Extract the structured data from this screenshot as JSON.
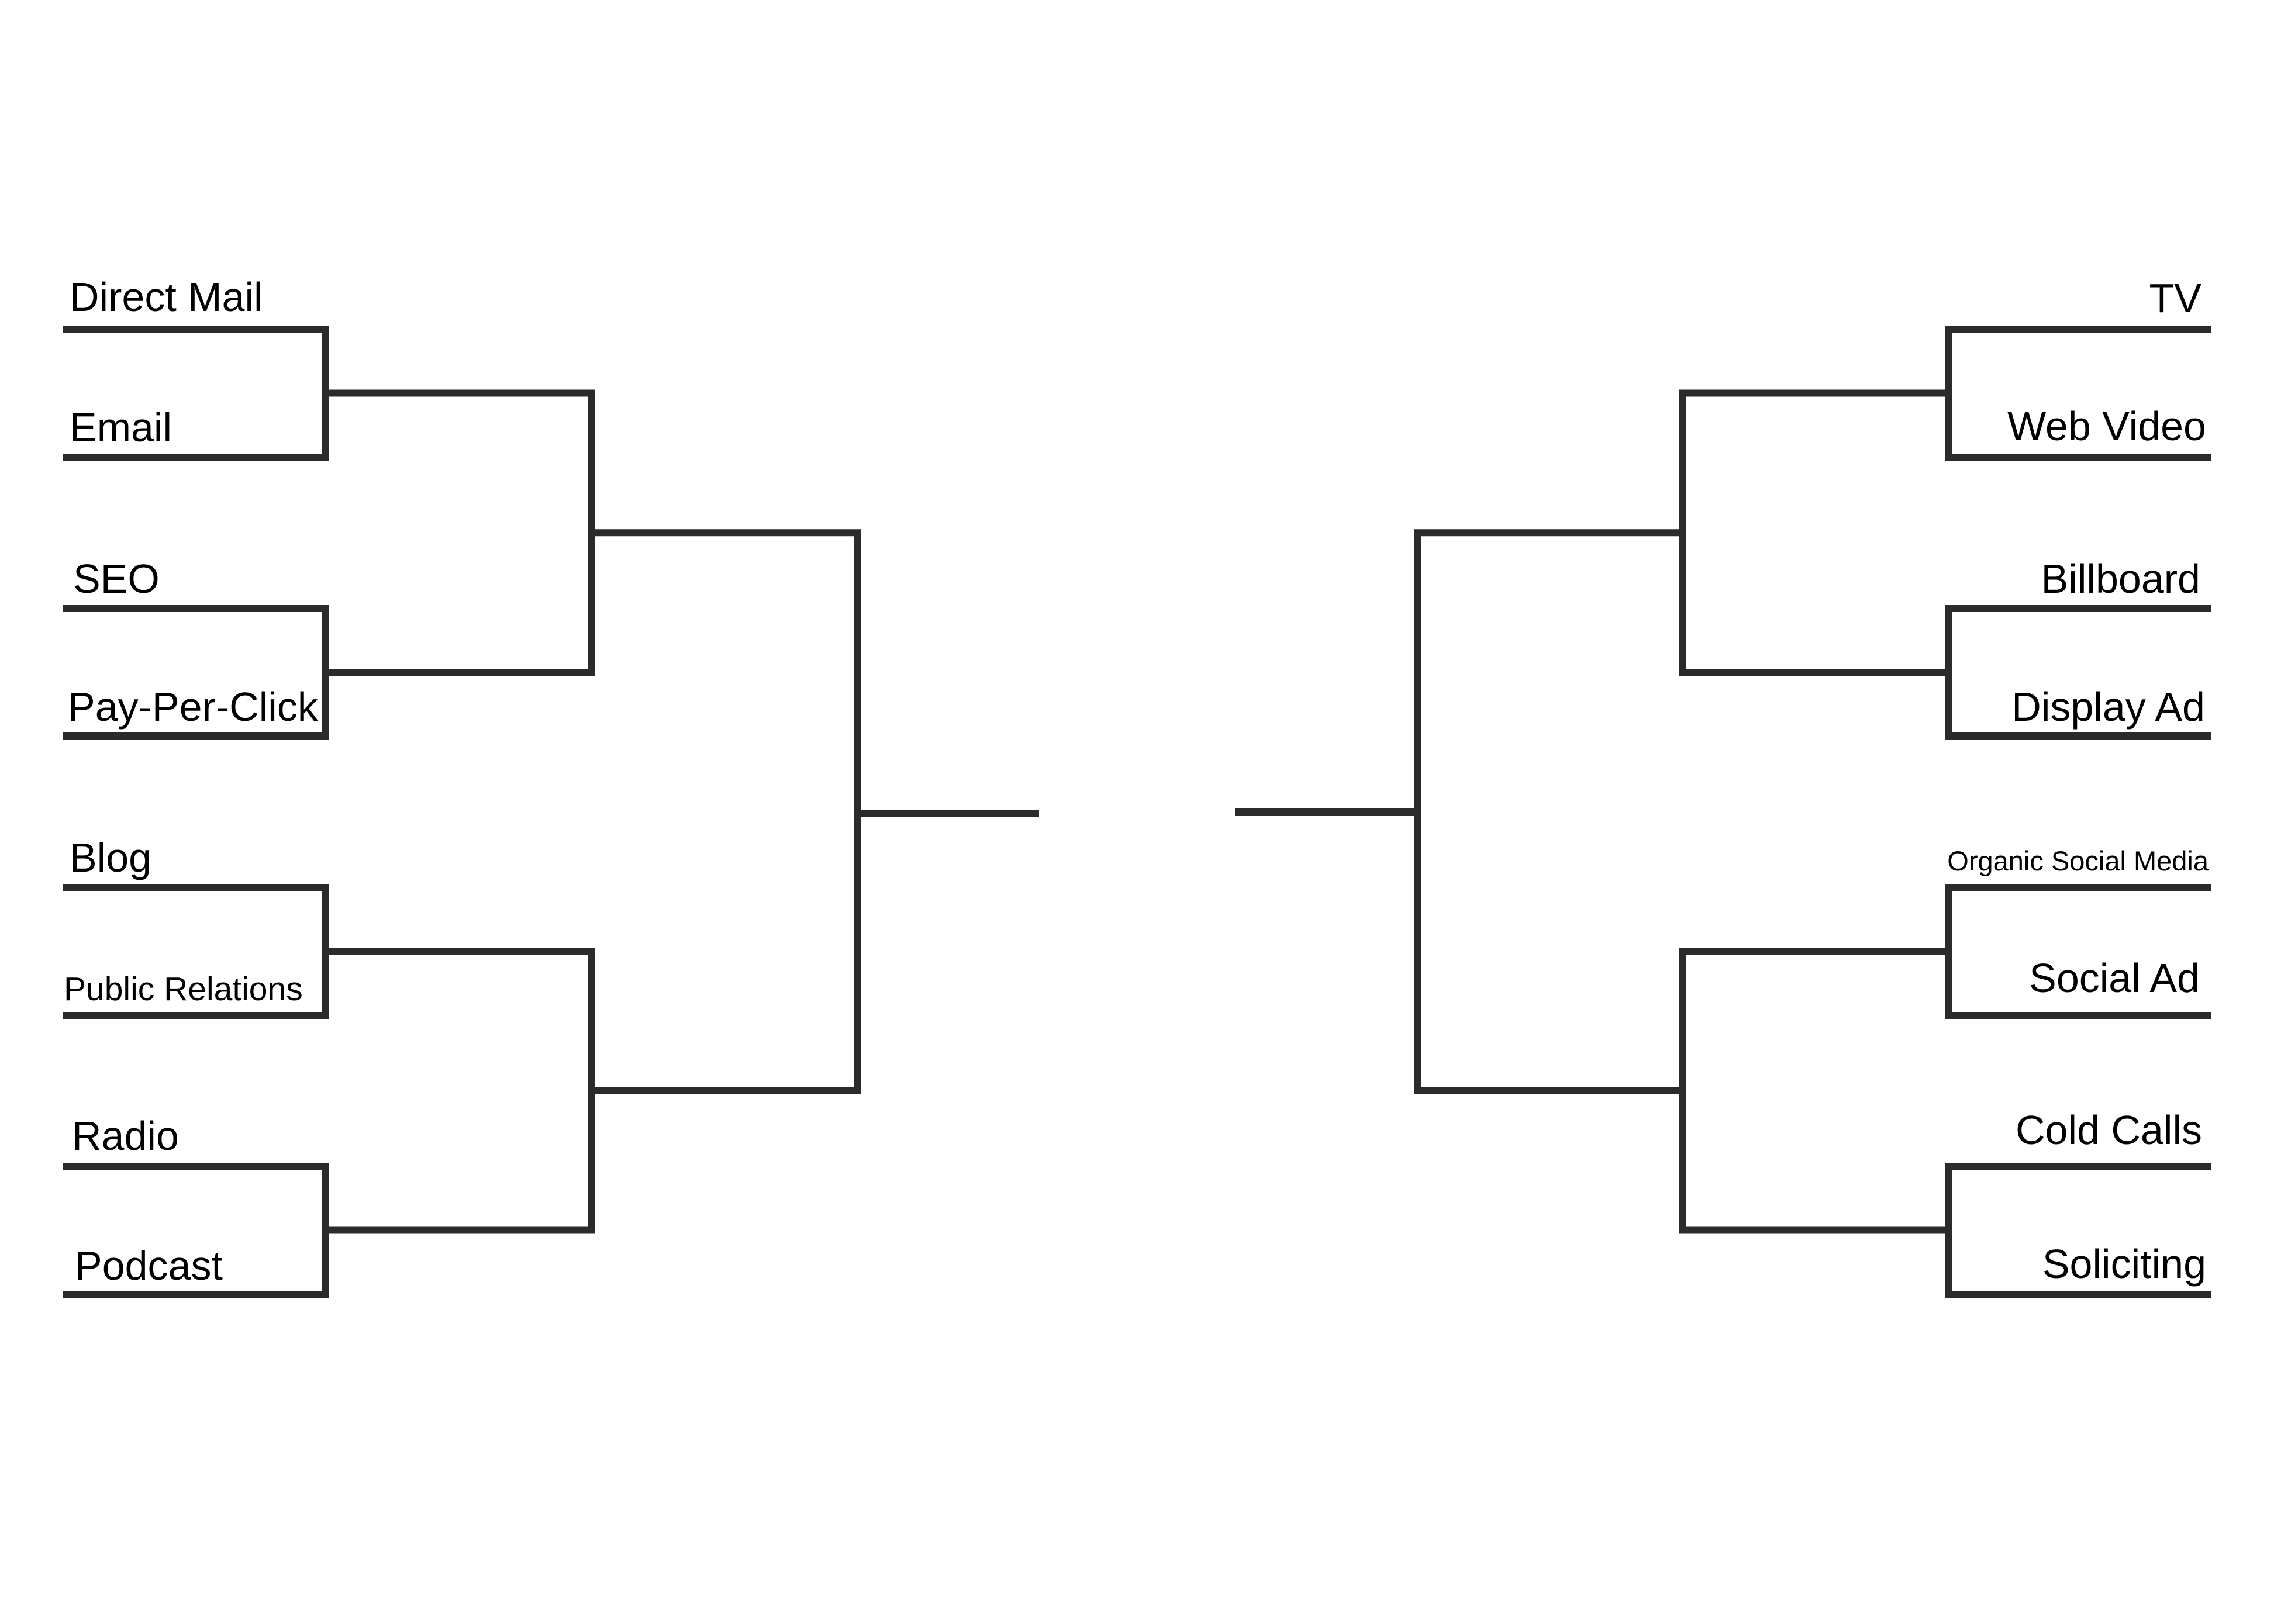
{
  "diagram": {
    "type": "tournament-bracket",
    "rounds_per_side": 3,
    "line_color": "#2b2b2b",
    "left": {
      "entries": [
        {
          "label": "Direct Mail"
        },
        {
          "label": "Email"
        },
        {
          "label": "SEO"
        },
        {
          "label": "Pay-Per-Click"
        },
        {
          "label": "Blog"
        },
        {
          "label": "Public Relations"
        },
        {
          "label": "Radio"
        },
        {
          "label": "Podcast"
        }
      ]
    },
    "right": {
      "entries": [
        {
          "label": "TV"
        },
        {
          "label": "Web Video"
        },
        {
          "label": "Billboard"
        },
        {
          "label": "Display Ad"
        },
        {
          "label": "Organic Social Media"
        },
        {
          "label": "Social Ad"
        },
        {
          "label": "Cold Calls"
        },
        {
          "label": "Soliciting"
        }
      ]
    },
    "matchups_round1": [
      [
        "Direct Mail",
        "Email"
      ],
      [
        "SEO",
        "Pay-Per-Click"
      ],
      [
        "Blog",
        "Public Relations"
      ],
      [
        "Radio",
        "Podcast"
      ],
      [
        "TV",
        "Web Video"
      ],
      [
        "Billboard",
        "Display Ad"
      ],
      [
        "Organic Social Media",
        "Social Ad"
      ],
      [
        "Cold Calls",
        "Soliciting"
      ]
    ],
    "winners": []
  }
}
